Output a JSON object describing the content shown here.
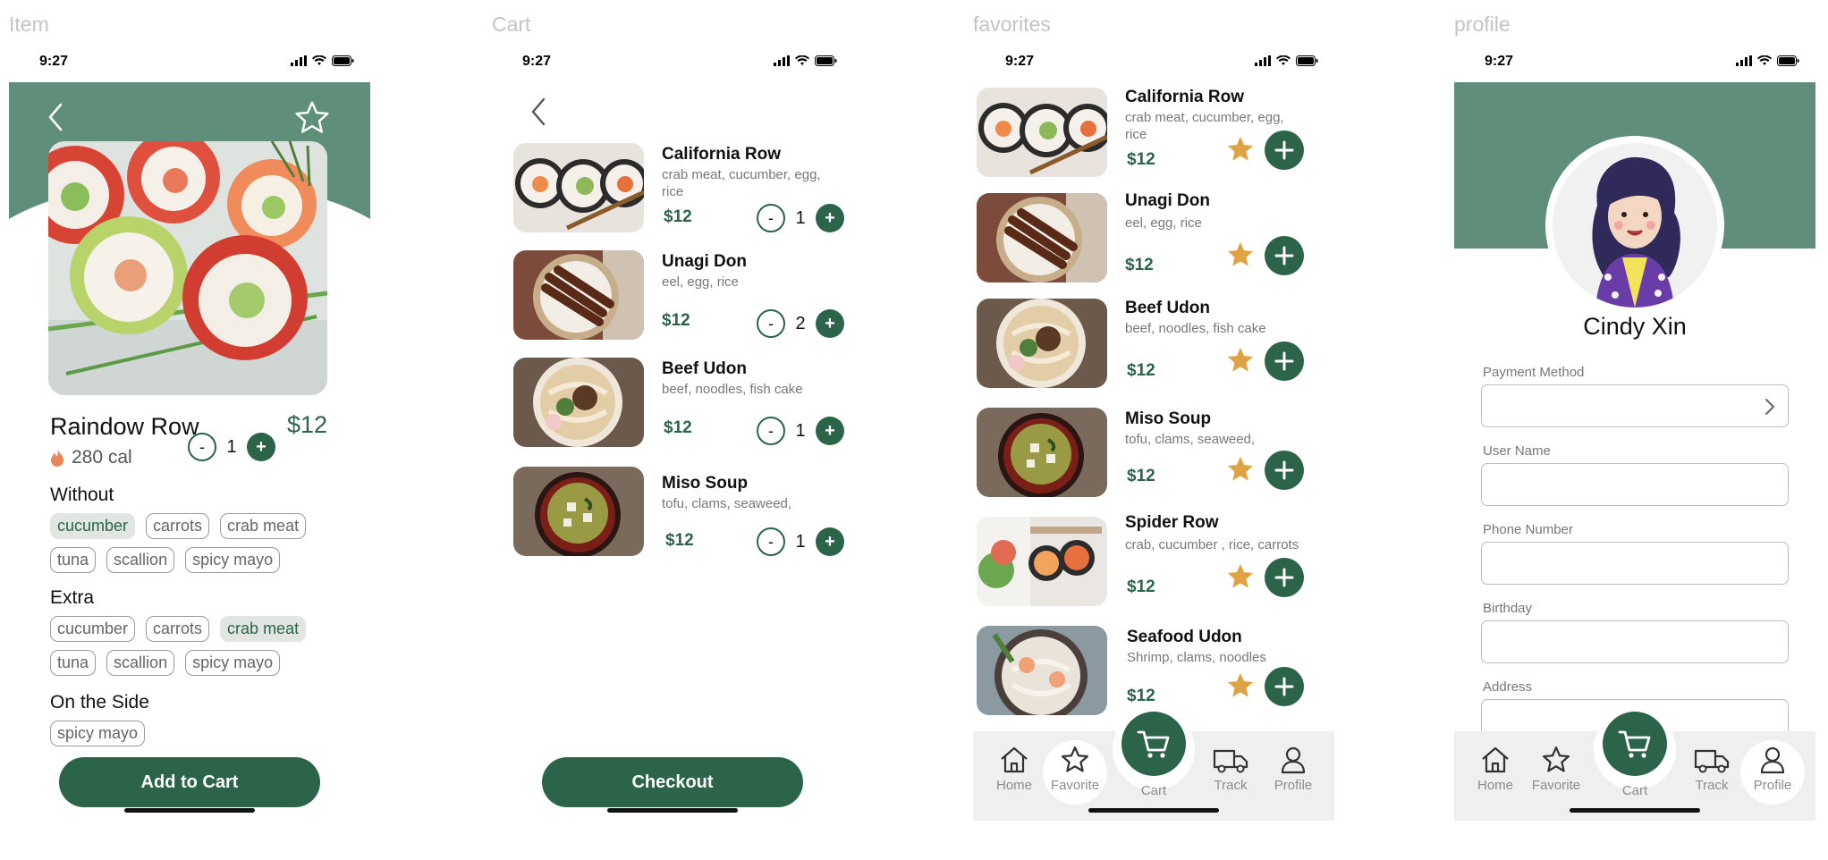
{
  "frames": {
    "item": "Item",
    "cart": "Cart",
    "favorites": "favorites",
    "profile": "profile"
  },
  "status": {
    "time": "9:27"
  },
  "colors": {
    "header_green": "#5f8f7b",
    "primary": "#2b6448",
    "star": "#e0a341"
  },
  "item": {
    "title": "Raindow Row",
    "price": "$12",
    "calories": "280 cal",
    "quantity": "1",
    "minus": "-",
    "plus": "+",
    "without_label": "Without",
    "without_chips": [
      {
        "label": "cucumber",
        "selected": true
      },
      {
        "label": "carrots",
        "selected": false
      },
      {
        "label": "crab meat",
        "selected": false
      },
      {
        "label": "tuna",
        "selected": false
      },
      {
        "label": "scallion",
        "selected": false
      },
      {
        "label": "spicy mayo",
        "selected": false
      }
    ],
    "extra_label": "Extra",
    "extra_chips": [
      {
        "label": "cucumber",
        "selected": false
      },
      {
        "label": "carrots",
        "selected": false
      },
      {
        "label": "crab meat",
        "selected": true
      },
      {
        "label": "tuna",
        "selected": false
      },
      {
        "label": "scallion",
        "selected": false
      },
      {
        "label": "spicy mayo",
        "selected": false
      }
    ],
    "side_label": "On the Side",
    "side_chips": [
      {
        "label": "spicy mayo",
        "selected": false
      }
    ],
    "add_to_cart": "Add to Cart"
  },
  "cart": {
    "items": [
      {
        "name": "California Row",
        "desc": "crab meat, cucumber, egg, rice",
        "price": "$12",
        "qty": "1"
      },
      {
        "name": "Unagi Don",
        "desc": "eel, egg, rice",
        "price": "$12",
        "qty": "2"
      },
      {
        "name": "Beef Udon",
        "desc": "beef, noodles, fish cake",
        "price": "$12",
        "qty": "1"
      },
      {
        "name": "Miso Soup",
        "desc": "tofu, clams, seaweed,",
        "price": "$12",
        "qty": "1"
      }
    ],
    "checkout": "Checkout"
  },
  "favorites": {
    "items": [
      {
        "name": "California Row",
        "desc": "crab meat, cucumber, egg, rice",
        "price": "$12"
      },
      {
        "name": "Unagi Don",
        "desc": "eel, egg, rice",
        "price": "$12"
      },
      {
        "name": "Beef Udon",
        "desc": "beef, noodles, fish cake",
        "price": "$12"
      },
      {
        "name": "Miso Soup",
        "desc": "tofu, clams, seaweed,",
        "price": "$12"
      },
      {
        "name": "Spider Row",
        "desc": "crab, cucumber , rice, carrots",
        "price": "$12"
      },
      {
        "name": "Seafood Udon",
        "desc": "Shrimp, clams, noodles",
        "price": "$12"
      }
    ]
  },
  "nav": {
    "home": "Home",
    "favorite": "Favorite",
    "cart": "Cart",
    "track": "Track",
    "profile": "Profile"
  },
  "profile": {
    "name": "Cindy Xin",
    "fields": [
      "Payment Method",
      "User Name",
      "Phone Number",
      "Birthday",
      "Address"
    ]
  }
}
